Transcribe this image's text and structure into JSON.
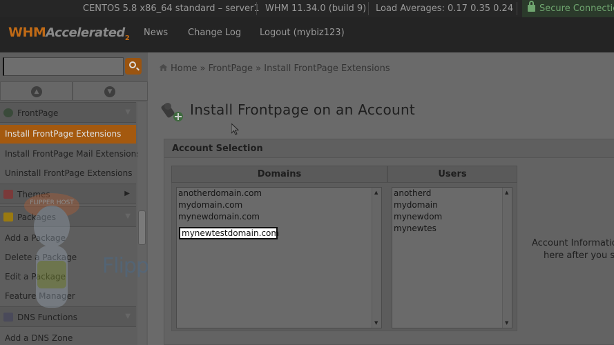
{
  "statusbar": {
    "os": "CENTOS 5.8 x86_64 standard – server1",
    "version": "WHM 11.34.0 (build 9)",
    "load": "Load Averages: 0.17 0.35 0.24",
    "secure": "Secure Connection"
  },
  "header": {
    "logo_whm": "WHM",
    "logo_accel": "Accelerated",
    "logo_num": "2",
    "nav": [
      "News",
      "Change Log",
      "Logout (mybiz123)"
    ]
  },
  "sidebar": {
    "search_value": "",
    "sections": [
      {
        "label": "FrontPage",
        "items": [
          "Install FrontPage Extensions",
          "Install FrontPage Mail Extensions",
          "Uninstall FrontPage Extensions"
        ]
      },
      {
        "label": "Themes"
      },
      {
        "label": "Packages",
        "items": [
          "Add a Package",
          "Delete a Package",
          "Edit a Package",
          "Feature Manager"
        ]
      },
      {
        "label": "DNS Functions",
        "items": [
          "Add a DNS Zone"
        ]
      }
    ],
    "watermark": "FlipperHost",
    "mascot_text": "FLIPPER HOST"
  },
  "main": {
    "breadcrumb": {
      "home": "Home",
      "sep": "»",
      "crumb1": "FrontPage",
      "crumb2": "Install FrontPage Extensions"
    },
    "title": "Install Frontpage on an Account",
    "panel_title": "Account Selection",
    "domains_header": "Domains",
    "users_header": "Users",
    "domains": [
      "anotherdomain.com",
      "mydomain.com",
      "mynewdomain.com",
      "mynewtestdomain.com"
    ],
    "users": [
      "anotherd",
      "mydomain",
      "mynewdom",
      "mynewtes"
    ],
    "info_line1": "Account Information",
    "info_line2": "here after you se"
  }
}
